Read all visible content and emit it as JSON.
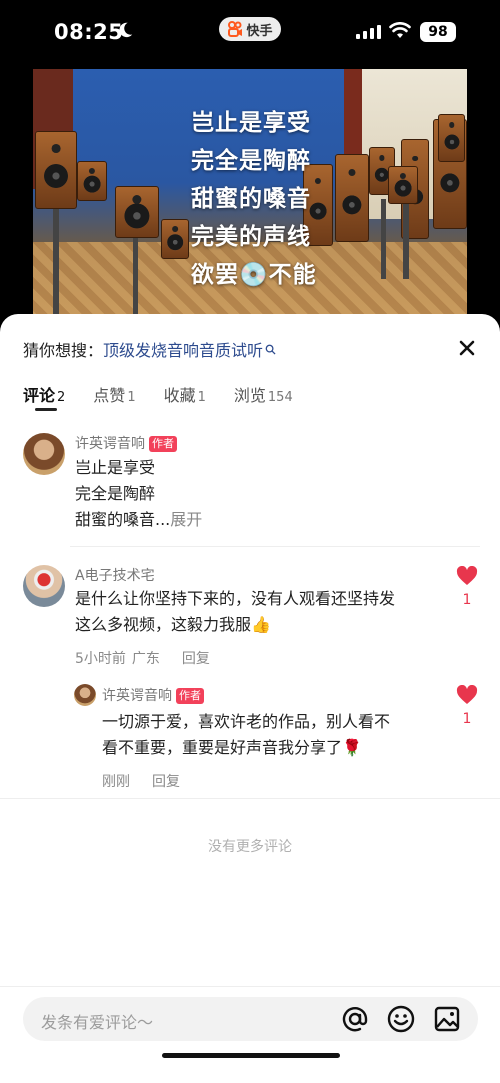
{
  "status_bar": {
    "time": "08:25",
    "app_badge": "快手",
    "battery": "98"
  },
  "video": {
    "caption_lines": [
      "岂止是享受",
      "完全是陶醉",
      "甜蜜的嗓音",
      "完美的声线",
      "欲罢💿不能"
    ]
  },
  "comments_panel": {
    "guess_prefix": "猜你想搜：",
    "guess_query": "顶级发烧音响音质试听",
    "tabs": [
      {
        "label": "评论",
        "count": "2"
      },
      {
        "label": "点赞",
        "count": "1"
      },
      {
        "label": "收藏",
        "count": "1"
      },
      {
        "label": "浏览",
        "count": "154"
      }
    ],
    "comments": [
      {
        "user": "许英谔音响",
        "tag": "作者",
        "lines": [
          "岂止是享受",
          "完全是陶醉",
          "甜蜜的嗓音..."
        ],
        "expand": "展开"
      },
      {
        "user": "A电子技术宅",
        "lines": [
          "是什么让你坚持下来的，没有人观看还坚持发",
          "这么多视频，这毅力我服👍"
        ],
        "time": "5小时前",
        "location": "广东",
        "reply_label": "回复",
        "likes": "1",
        "reply": {
          "user": "许英谔音响",
          "tag": "作者",
          "lines": [
            "一切源于爱，喜欢许老的作品，别人看不",
            "看不重要，重要是好声音我分享了🌹"
          ],
          "time": "刚刚",
          "reply_label": "回复",
          "likes": "1"
        }
      }
    ],
    "no_more": "没有更多评论"
  },
  "input_bar": {
    "placeholder": "发条有爱评论～",
    "icons": [
      "at-icon",
      "emoji-icon",
      "image-icon"
    ]
  },
  "colors": {
    "author_tag": "#f2415a",
    "like": "#e8364d",
    "link": "#2d4b8e"
  }
}
